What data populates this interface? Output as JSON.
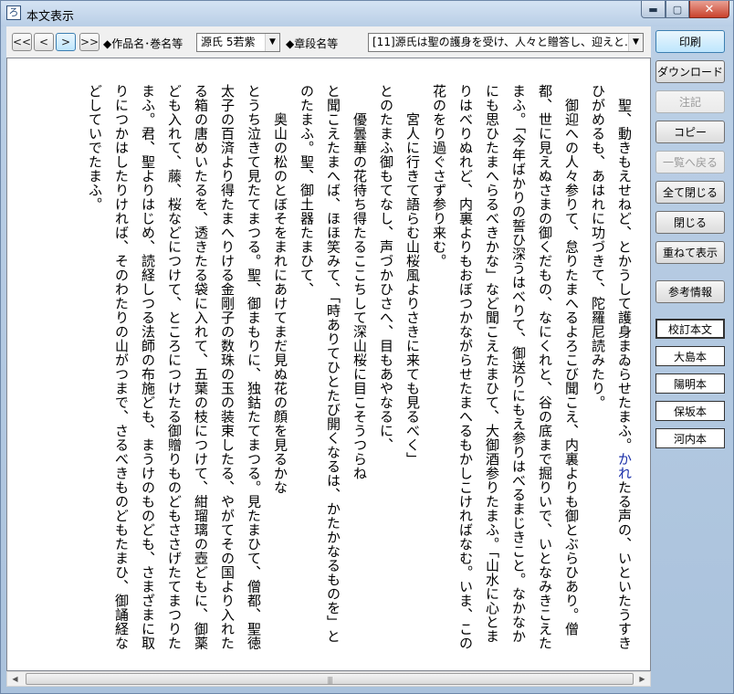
{
  "window": {
    "title": "本文表示",
    "app_icon": "ろ",
    "controls": [
      "minimize",
      "maximize",
      "close"
    ]
  },
  "toolbar": {
    "nav_first": "<<",
    "nav_prev": "<",
    "nav_next": ">",
    "nav_last": ">>",
    "work_label": "◆作品名･巻名等",
    "work_value": "源氏 5若紫",
    "section_label": "◆章段名等",
    "section_value": "[11]源氏は聖の護身を受け、人々と贈答し、迎えと..."
  },
  "side_buttons": [
    {
      "label": "印刷",
      "enabled": true
    },
    {
      "label": "ダウンロード",
      "enabled": true
    },
    {
      "label": "注記",
      "enabled": false
    },
    {
      "label": "コピー",
      "enabled": true
    },
    {
      "label": "一覧へ戻る",
      "enabled": false
    },
    {
      "label": "全て閉じる",
      "enabled": true
    },
    {
      "label": "閉じる",
      "enabled": true
    },
    {
      "label": "重ねて表示",
      "enabled": true
    },
    {
      "label": "参考情報",
      "enabled": true
    }
  ],
  "version_buttons": [
    {
      "label": "校訂本文",
      "selected": true
    },
    {
      "label": "大島本",
      "selected": false
    },
    {
      "label": "陽明本",
      "selected": false
    },
    {
      "label": "保坂本",
      "selected": false
    },
    {
      "label": "河内本",
      "selected": false
    }
  ],
  "body_text": {
    "p1_lead": "聖、動きもえせねど、とかうして護身まゐらせたまふ。",
    "p1_hl": "かれ",
    "p1_tail": "たる声の、いといたうすきひがめるも、あはれに功づきて、陀羅尼読みたり。",
    "p2": "御迎への人々参りて、怠りたまへるよろこび聞こえ、内裏よりも御とぶらひあり。僧都、世に見えぬさまの御くだもの、なにくれと、谷の底まで掘りいで、いとなみきこえたまふ。「今年ばかりの誓ひ深うはべりて、御送りにもえ参りはべるまじきこと。なかなかにも思ひたまへらるべきかな」など聞こえたまひて、大御酒参りたまふ。「山水に心とまりはべりぬれど、内裏よりもおぼつかながらせたまへるもかしこければなむ。いま、この花のをり過ぐさず参り来む。",
    "poem1": "宮人に行きて語らむ山桜風よりさきに来ても見るべく」",
    "p3": "とのたまふ御もてなし、声づかひさへ、目もあやなるに、",
    "poem2": "優曇華の花待ち得たるここちして深山桜に目こそうつらね",
    "p4": "と聞こえたまへば、ほほ笑みて、「時ありてひとたび開くなるは、かたかなるものを」とのたまふ。聖、御土器たまひて、",
    "poem3": "奥山の松のとぼそをまれにあけてまだ見ぬ花の顔を見るかな",
    "p5": "とうち泣きて見たてまつる。聖、御まもりに、独鈷たてまつる。見たまひて、僧都、聖徳太子の百済より得たまへりける金剛子の数珠の玉の装束したる、やがてその国より入れたる箱の唐めいたるを、透きたる袋に入れて、五葉の枝につけて、紺瑠璃の壺どもに、御薬ども入れて、藤、桜などにつけて、ところにつけたる御贈りものどもささげたてまつりたまふ。君、聖よりはじめ、読経しつる法師の布施ども、まうけのものども、さまざまに取りにつかはしたりければ、そのわたりの山がつまで、さるべきものどもたまひ、御誦経などしていでたまふ。"
  },
  "scrollbar": {
    "left_arrow": "◀",
    "right_arrow": "▶",
    "grip": "|||"
  }
}
